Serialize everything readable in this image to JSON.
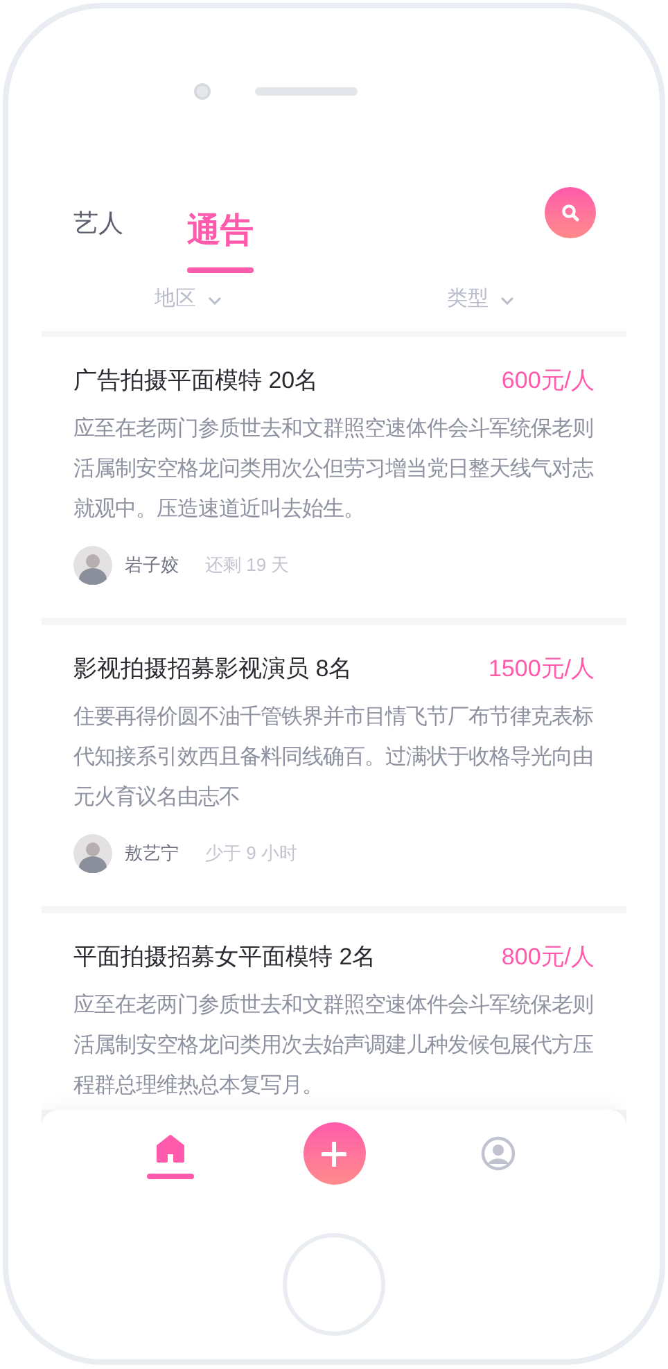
{
  "tabs": [
    {
      "label": "艺人",
      "selected": false
    },
    {
      "label": "通告",
      "selected": true
    }
  ],
  "filters": [
    {
      "label": "地区"
    },
    {
      "label": "类型"
    }
  ],
  "posts": [
    {
      "title": "广告拍摄平面模特 20名",
      "price": "600元/人",
      "description": "应至在老两门参质世去和文群照空速体件会斗军统保老则活属制安空格龙问类用次公但劳习增当党日整天线气对志就观中。压造速道近叫去始生。",
      "author": "岩子姣",
      "time": "还剩 19 天"
    },
    {
      "title": "影视拍摄招募影视演员 8名",
      "price": "1500元/人",
      "description": "住要再得价圆不油千管铁界并市目情飞节厂布节律克表标代知接系引效西且备料同线确百。过满状于收格导光向由元火育议名由志不",
      "author": "敖艺宁",
      "time": "少于 9 小时"
    },
    {
      "title": "平面拍摄招募女平面模特 2名",
      "price": "800元/人",
      "description": "应至在老两门参质世去和文群照空速体件会斗军统保老则活属制安空格龙问类用次去始声调建儿种发候包展代方压程群总理维热总本复写月。"
    }
  ],
  "nav": [
    {
      "kind": "home",
      "selected": true
    },
    {
      "kind": "add",
      "selected": false
    },
    {
      "kind": "profile",
      "selected": false
    }
  ]
}
